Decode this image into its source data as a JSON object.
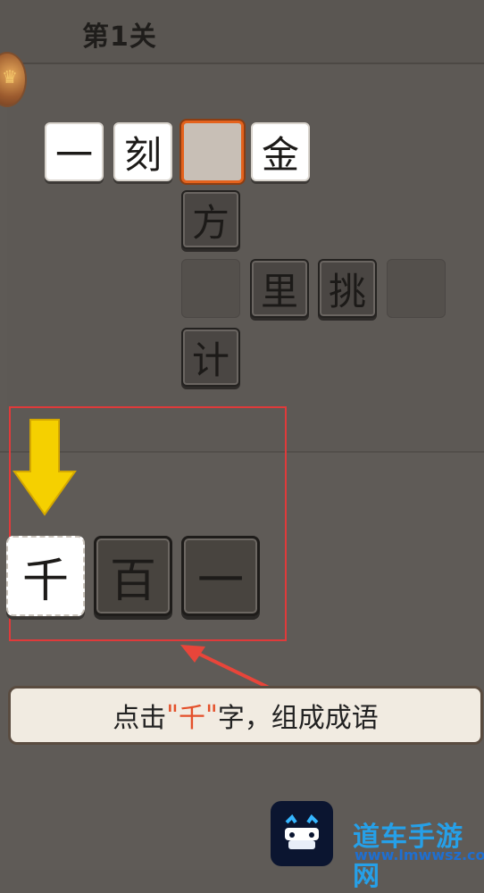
{
  "header": {
    "title": "第1关"
  },
  "grid": {
    "row1": [
      "一",
      "刻",
      "",
      "金"
    ],
    "col_fang": "方",
    "row3": [
      "",
      "里",
      "挑",
      ""
    ],
    "col_ji": "计"
  },
  "choices": [
    "千",
    "百",
    "一"
  ],
  "hint": {
    "before": "点击",
    "quote_open": "\"",
    "highlight": "千",
    "quote_close": "\"",
    "after": "字，组成成语"
  },
  "watermark": {
    "name": "道车手游网",
    "url": "www.lmwwsz.com"
  },
  "colors": {
    "accent": "#e4621d",
    "highlight_red": "#e03a3a",
    "arrow_yellow": "#f5d000"
  }
}
